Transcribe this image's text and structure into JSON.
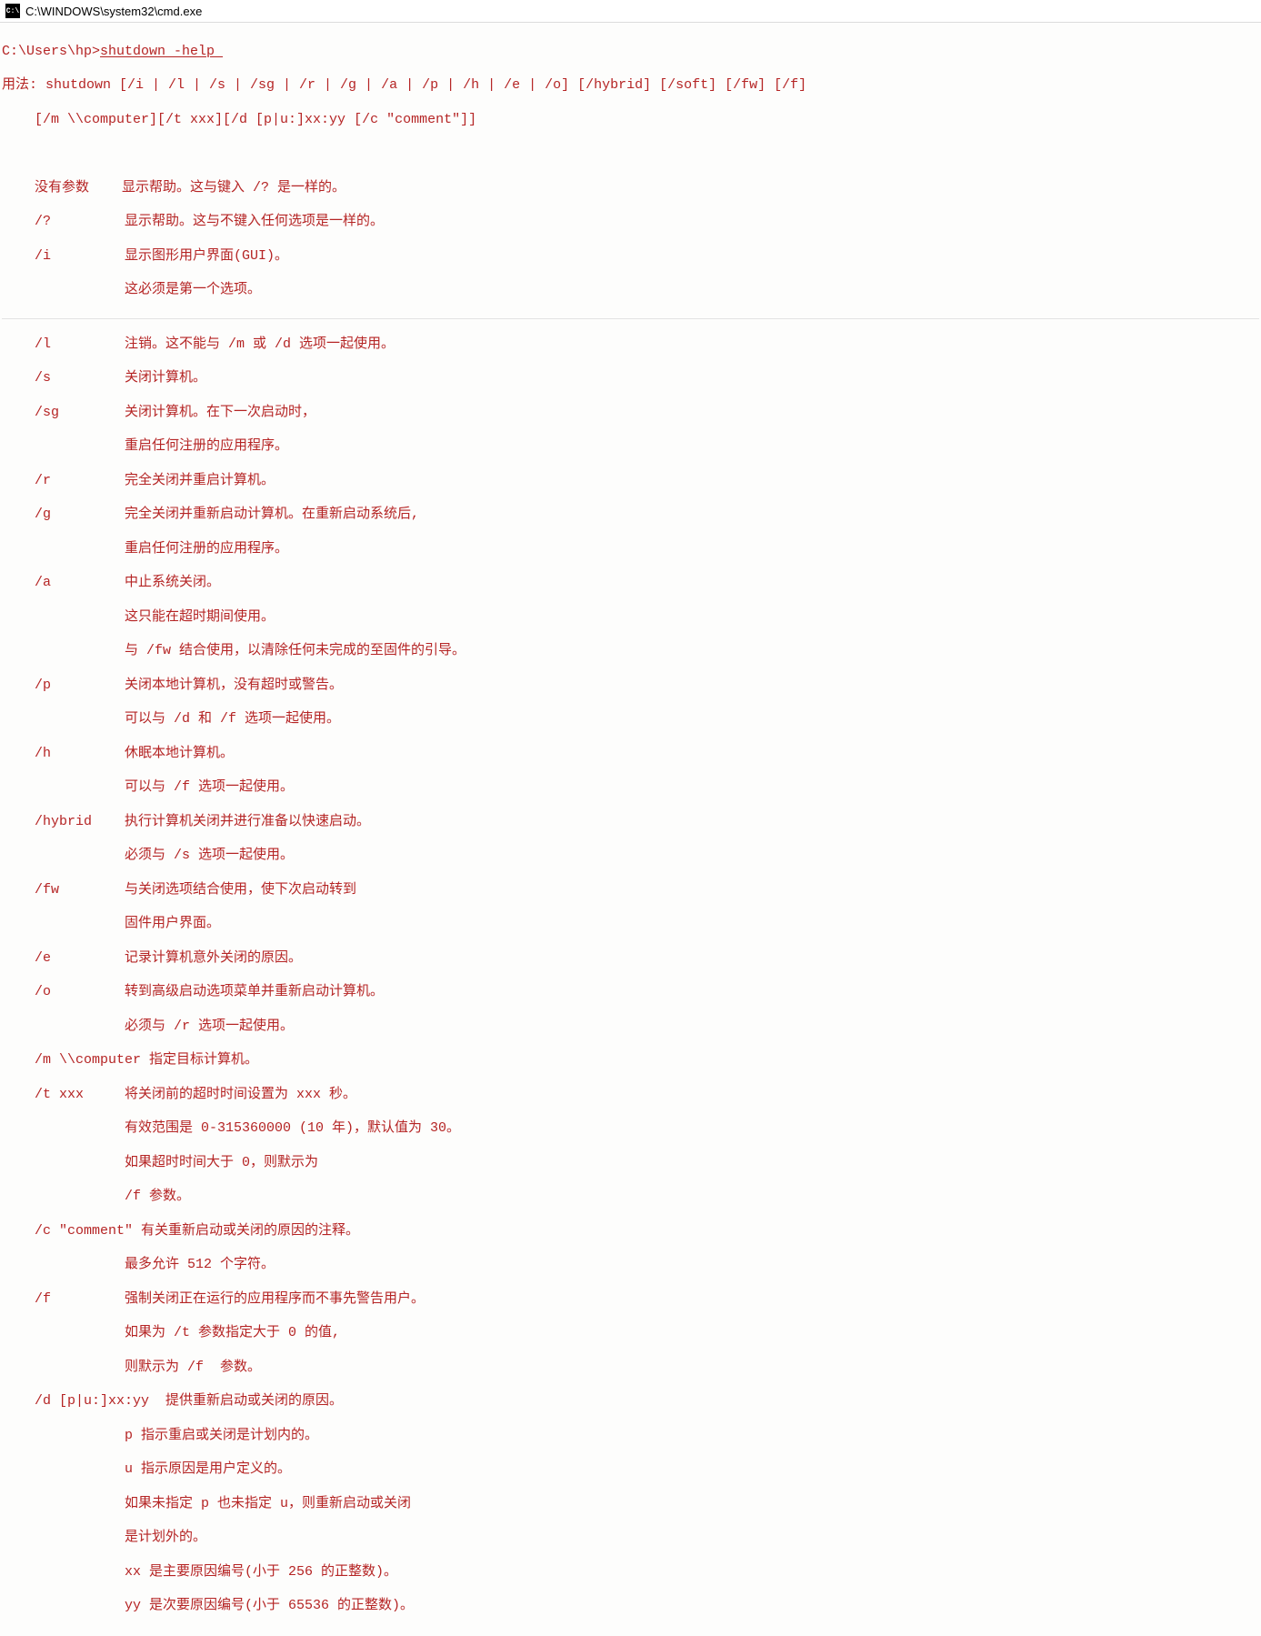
{
  "window": {
    "title": "C:\\WINDOWS\\system32\\cmd.exe"
  },
  "prompt": {
    "path": "C:\\Users\\hp>",
    "command": "shutdown -help "
  },
  "usage": {
    "line1": "用法: shutdown [/i | /l | /s | /sg | /r | /g | /a | /p | /h | /e | /o] [/hybrid] [/soft] [/fw] [/f]",
    "line2": "    [/m \\\\computer][/t xxx][/d [p|u:]xx:yy [/c \"comment\"]]"
  },
  "options": {
    "noarg": "    没有参数    显示帮助。这与键入 /? 是一样的。",
    "qmark": "    /?         显示帮助。这与不键入任何选项是一样的。",
    "i1": "    /i         显示图形用户界面(GUI)。",
    "i2": "               这必须是第一个选项。",
    "l": "    /l         注销。这不能与 /m 或 /d 选项一起使用。",
    "s": "    /s         关闭计算机。",
    "sg1": "    /sg        关闭计算机。在下一次启动时，",
    "sg2": "               重启任何注册的应用程序。",
    "r": "    /r         完全关闭并重启计算机。",
    "g1": "    /g         完全关闭并重新启动计算机。在重新启动系统后,",
    "g2": "               重启任何注册的应用程序。",
    "a1": "    /a         中止系统关闭。",
    "a2": "               这只能在超时期间使用。",
    "a3": "               与 /fw 结合使用，以清除任何未完成的至固件的引导。",
    "p1": "    /p         关闭本地计算机，没有超时或警告。",
    "p2": "               可以与 /d 和 /f 选项一起使用。",
    "h1": "    /h         休眠本地计算机。",
    "h2": "               可以与 /f 选项一起使用。",
    "hybrid1": "    /hybrid    执行计算机关闭并进行准备以快速启动。",
    "hybrid2": "               必须与 /s 选项一起使用。",
    "fw1": "    /fw        与关闭选项结合使用，使下次启动转到",
    "fw2": "               固件用户界面。",
    "e": "    /e         记录计算机意外关闭的原因。",
    "o1": "    /o         转到高级启动选项菜单并重新启动计算机。",
    "o2": "               必须与 /r 选项一起使用。",
    "m": "    /m \\\\computer 指定目标计算机。",
    "t1": "    /t xxx     将关闭前的超时时间设置为 xxx 秒。",
    "t2": "               有效范围是 0-315360000 (10 年)，默认值为 30。",
    "t3": "               如果超时时间大于 0，则默示为",
    "t4": "               /f 参数。",
    "c1": "    /c \"comment\" 有关重新启动或关闭的原因的注释。",
    "c2": "               最多允许 512 个字符。",
    "f1": "    /f         强制关闭正在运行的应用程序而不事先警告用户。",
    "f2": "               如果为 /t 参数指定大于 0 的值,",
    "f3": "               则默示为 /f  参数。",
    "d1": "    /d [p|u:]xx:yy  提供重新启动或关闭的原因。",
    "d2": "               p 指示重启或关闭是计划内的。",
    "d3": "               u 指示原因是用户定义的。",
    "d4": "               如果未指定 p 也未指定 u，则重新启动或关闭",
    "d5": "               是计划外的。",
    "d6": "               xx 是主要原因编号(小于 256 的正整数)。",
    "d7": "               yy 是次要原因编号(小于 65536 的正整数)。"
  }
}
